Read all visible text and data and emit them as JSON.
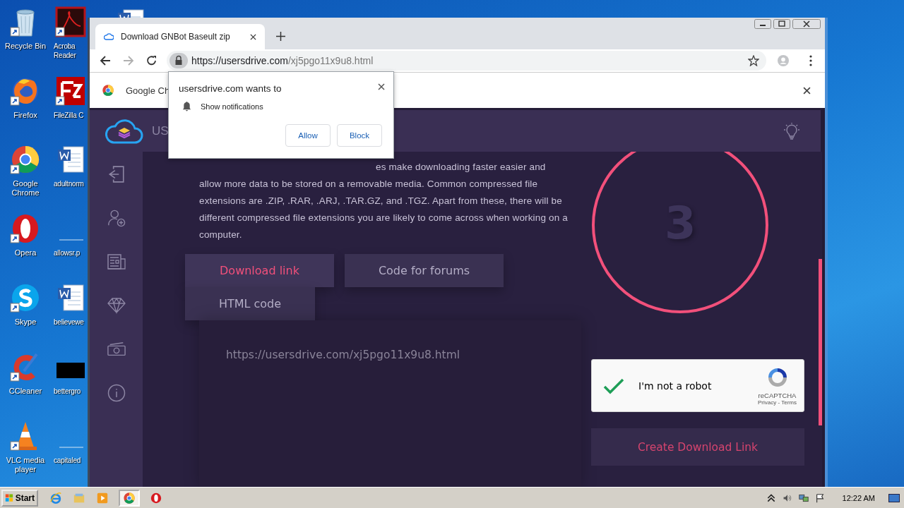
{
  "desktop": {
    "icons_left": [
      {
        "kind": "recycle",
        "lines": [
          "Recycle Bin"
        ]
      },
      {
        "kind": "firefox",
        "lines": [
          "Firefox"
        ]
      },
      {
        "kind": "chrome",
        "lines": [
          "Google",
          "Chrome"
        ]
      },
      {
        "kind": "opera",
        "lines": [
          "Opera"
        ]
      },
      {
        "kind": "skype",
        "lines": [
          "Skype"
        ]
      },
      {
        "kind": "ccleaner",
        "lines": [
          "CCleaner"
        ]
      },
      {
        "kind": "vlc",
        "lines": [
          "VLC media",
          "player"
        ]
      }
    ],
    "icons_right": [
      {
        "kind": "acrobat",
        "lines": [
          "Acroba",
          "Reader"
        ]
      },
      {
        "kind": "filezilla",
        "lines": [
          "FileZilla C"
        ]
      },
      {
        "kind": "word",
        "lines": [
          "adultnorm"
        ]
      },
      {
        "kind": "blank",
        "lines": [
          "allowsr.p"
        ]
      },
      {
        "kind": "word",
        "lines": [
          "believewe"
        ]
      },
      {
        "kind": "black",
        "lines": [
          "bettergro"
        ]
      },
      {
        "kind": "blank",
        "lines": [
          "capitaled"
        ]
      }
    ],
    "icon_behind_window": {
      "kind": "word"
    }
  },
  "browser": {
    "tab": {
      "title": "Download GNBot Baseult zip"
    },
    "address": {
      "host": "https://usersdrive.com",
      "path": "/xj5pgo11x9u8.html"
    },
    "infobar": {
      "text": "Google Ch"
    },
    "notification_popup": {
      "title": "usersdrive.com wants to",
      "permission": "Show notifications",
      "buttons": [
        "Allow",
        "Block"
      ]
    },
    "page": {
      "logo_text": "US",
      "paragraph": "es make downloading faster easier and allow more data to be stored on a removable media. Common compressed file extensions are .ZIP, .RAR, .ARJ, .TAR.GZ, and .TGZ. Apart from these, there will be different compressed file extensions you are likely to come across when working on a computer.",
      "tabs": [
        {
          "label": "Download link",
          "selected": true
        },
        {
          "label": "Code for forums",
          "selected": false
        },
        {
          "label": "HTML code",
          "selected": false
        }
      ],
      "link_code": "https://usersdrive.com/xj5pgo11x9u8.html",
      "countdown": "3",
      "captcha": {
        "label": "I'm not a robot",
        "checked": true,
        "brand": "reCAPTCHA",
        "links": "Privacy - Terms"
      },
      "create_button": "Create Download Link"
    }
  },
  "taskbar": {
    "start": "Start",
    "apps": [
      {
        "kind": "ie",
        "active": false
      },
      {
        "kind": "explorer",
        "active": false
      },
      {
        "kind": "media",
        "active": false
      },
      {
        "kind": "chrome",
        "active": true
      },
      {
        "kind": "opera",
        "active": false
      }
    ],
    "clock": "12:22 AM"
  }
}
